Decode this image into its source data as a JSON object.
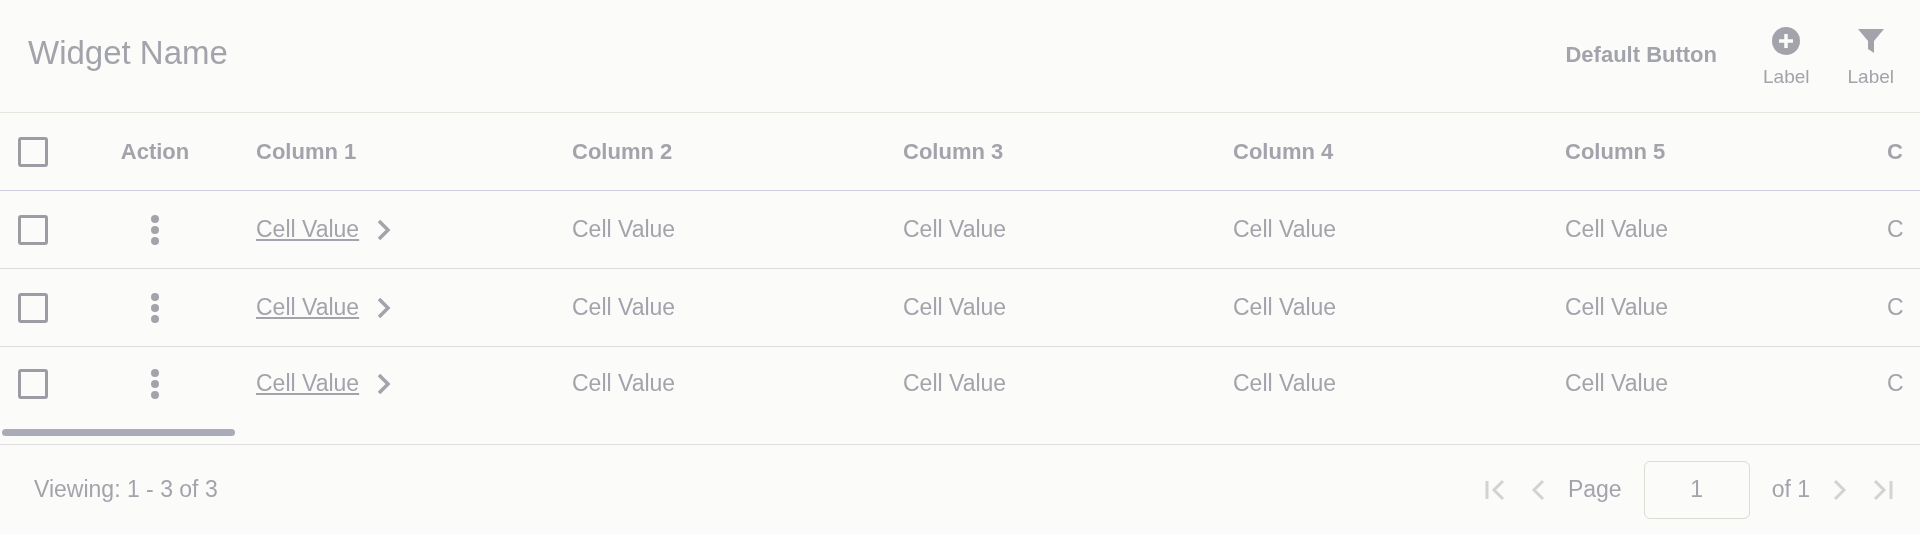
{
  "widget": {
    "title": "Widget Name"
  },
  "toolbar": {
    "button": "Default Button",
    "icon_buttons": [
      {
        "kind": "add",
        "label": "Label"
      },
      {
        "kind": "filter",
        "label": "Label"
      }
    ]
  },
  "table": {
    "select_all": {
      "checked": false
    },
    "action_heading": "Action",
    "columns": [
      {
        "label": "Column 1",
        "kind": "link"
      },
      {
        "label": "Column 2",
        "kind": "text"
      },
      {
        "label": "Column 3",
        "kind": "text"
      },
      {
        "label": "Column 4",
        "kind": "text"
      },
      {
        "label": "Column 5",
        "kind": "text"
      },
      {
        "label": "C",
        "kind": "text"
      }
    ],
    "rows": [
      {
        "checked": false,
        "cells": [
          "Cell Value",
          "Cell Value",
          "Cell Value",
          "Cell Value",
          "Cell Value",
          "C"
        ]
      },
      {
        "checked": false,
        "cells": [
          "Cell Value",
          "Cell Value",
          "Cell Value",
          "Cell Value",
          "Cell Value",
          "C"
        ]
      },
      {
        "checked": false,
        "cells": [
          "Cell Value",
          "Cell Value",
          "Cell Value",
          "Cell Value",
          "Cell Value",
          "C"
        ]
      }
    ]
  },
  "footer": {
    "viewing": "Viewing: 1 - 3 of 3",
    "page_label": "Page",
    "page_value": "1",
    "page_total": "of 1",
    "nav": [
      {
        "kind": "first",
        "disabled": true
      },
      {
        "kind": "prev",
        "disabled": true
      },
      {
        "kind": "next",
        "disabled": true
      },
      {
        "kind": "last",
        "disabled": true
      }
    ]
  }
}
